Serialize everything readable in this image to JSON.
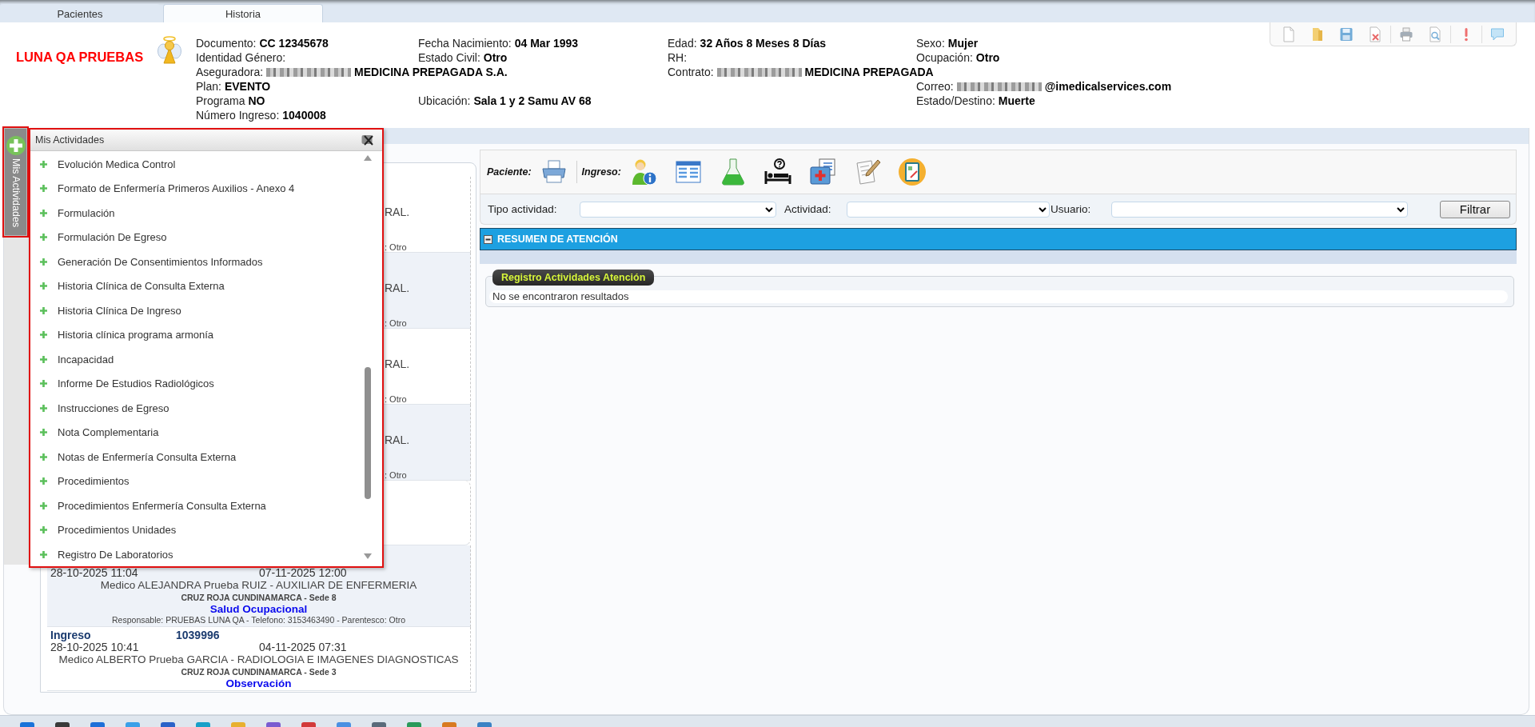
{
  "tabs": [
    {
      "label": "Pacientes",
      "selected": false
    },
    {
      "label": "Historia",
      "selected": true
    }
  ],
  "patient": {
    "name": "LUNA QA PRUEBAS",
    "fields": [
      {
        "label": "Documento:",
        "value": "CC 12345678"
      },
      {
        "label": "Fecha Nacimiento:",
        "value": "04 Mar 1993"
      },
      {
        "label": "Edad:",
        "value": "32 Años 8 Meses 8 Días"
      },
      {
        "label": "Sexo:",
        "value": "Mujer"
      },
      {
        "label": "Identidad Género:"
      },
      {
        "label": "Estado Civil:",
        "value": "Otro"
      },
      {
        "label": "RH:"
      },
      {
        "label": "Ocupación:",
        "value": "Otro"
      },
      {
        "label": "Aseguradora:",
        "value": "MEDICINA PREPAGADA S.A.",
        "redacted_prefix": true
      },
      {
        "label": "Contrato:",
        "value": "MEDICINA PREPAGADA",
        "redacted_prefix": true
      },
      {
        "label": "Plan:",
        "value": "EVENTO"
      },
      {
        "label": "Correo:",
        "value": "@imedicalservices.com",
        "redacted_prefix": true
      },
      {
        "label": "Programa",
        "value": "NO"
      },
      {
        "label": "Ubicación:",
        "value": "Sala 1 y 2 Samu AV 68"
      },
      {
        "label": "Estado/Destino:",
        "value": "Muerte"
      },
      {
        "label": "Número Ingreso:",
        "value": "1040008"
      }
    ]
  },
  "activities_tab": {
    "label": "Mis Actividades"
  },
  "activities_popup": {
    "title": "Mis Actividades",
    "items": [
      "Evolución Medica Control",
      "Formato de Enfermería Primeros Auxilios - Anexo 4",
      "Formulación",
      "Formulación De Egreso",
      "Generación De Consentimientos Informados",
      "Historia Clínica de Consulta Externa",
      "Historia Clínica De Ingreso",
      "Historia clínica programa armonía",
      "Incapacidad",
      "Informe De Estudios Radiológicos",
      "Instrucciones de Egreso",
      "Nota Complementaria",
      "Notas de Enfermería Consulta Externa",
      "Procedimientos",
      "Procedimientos Enfermería Consulta Externa",
      "Procedimientos Unidades",
      "Registro De Laboratorios"
    ]
  },
  "admissions": [
    {
      "kind": "covered",
      "doctor": "RAL.",
      "responsible": ": Otro"
    },
    {
      "kind": "covered",
      "doctor": "RAL.",
      "responsible": ": Otro"
    },
    {
      "kind": "covered",
      "doctor": "RAL.",
      "responsible": ": Otro"
    },
    {
      "kind": "covered",
      "doctor": "RAL.",
      "responsible": ": Otro"
    },
    {
      "kind": "covered"
    },
    {
      "kind": "entry",
      "admitted": "28-10-2025 11:04",
      "discharged": "07-11-2025 12:00",
      "doctor": "Medico ALEJANDRA Prueba RUIZ - AUXILIAR DE ENFERMERIA",
      "site": "CRUZ ROJA CUNDINAMARCA - Sede 8",
      "service": "Salud Ocupacional",
      "responsible": "Responsable: PRUEBAS LUNA QA - Telefono: 3153463490 - Parentesco: Otro"
    },
    {
      "kind": "entry",
      "label": "Ingreso",
      "number": "1039996",
      "admitted": "28-10-2025 10:41",
      "discharged": "04-11-2025 07:31",
      "doctor": "Medico ALBERTO Prueba GARCIA - RADIOLOGIA E IMAGENES DIAGNOSTICAS",
      "site": "CRUZ ROJA CUNDINAMARCA - Sede 3",
      "service": "Observación"
    }
  ],
  "action_bar": {
    "patient_label": "Paciente:",
    "admission_label": "Ingreso:"
  },
  "filters": {
    "fields": [
      {
        "label": "Tipo actividad:"
      },
      {
        "label": "Actividad:"
      },
      {
        "label": "Usuario:"
      }
    ],
    "button": "Filtrar"
  },
  "summary": {
    "title": "RESUMEN DE ATENCIÓN",
    "expanded": true
  },
  "activity_log": {
    "title": "Registro Actividades Atención",
    "message": "No se encontraron resultados"
  }
}
